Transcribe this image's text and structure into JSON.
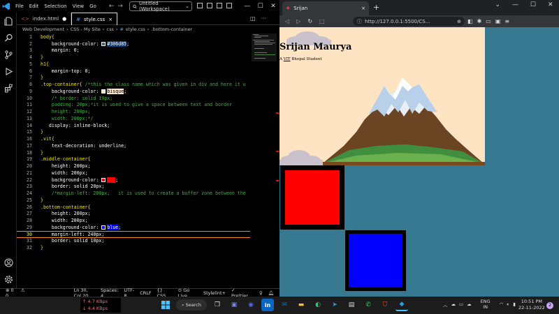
{
  "vscode": {
    "menu": [
      "File",
      "Edit",
      "Selection",
      "View",
      "Go"
    ],
    "command_center": "Untitled (Workspace)",
    "tabs": [
      {
        "label": "index.html",
        "modified": "●"
      },
      {
        "label": "style.css",
        "close": "×"
      }
    ],
    "breadcrumb": [
      "Web Development",
      "CSS - My Site",
      "css",
      "style.css",
      ".bottom-container"
    ],
    "breadcrumb_sep": "›",
    "window_controls": [
      "—",
      "☐",
      "✕"
    ],
    "status": {
      "errors": "0",
      "warnings": "0",
      "position": "Ln 30, Col 20",
      "spaces": "Spaces: 4",
      "encoding": "UTF-8",
      "eol": "CRLF",
      "language": "CSS",
      "golive": "Go Live",
      "stylelint": "Stylelint+",
      "prettier": "Prettier"
    },
    "line_numbers": [
      "1",
      "2",
      "3",
      "4",
      "5",
      "6",
      "7",
      "8",
      "9",
      "10",
      "11",
      "12",
      "13",
      "14",
      "15",
      "16",
      "17",
      "18",
      "19",
      "20",
      "21",
      "22",
      "23",
      "24",
      "25",
      "26",
      "27",
      "28",
      "29",
      "30",
      "31",
      "32"
    ],
    "code": {
      "l1a": "body{",
      "l2a": "background-color: ",
      "l2b": "#306d85",
      "l2c": ";",
      "l3a": "margin: ",
      "l3b": "0",
      "l3c": ";",
      "l4a": "}",
      "l5a": "h1{",
      "l6a": "margin-top: ",
      "l6b": "0",
      "l6c": ";",
      "l7a": "}",
      "l8a": ".top-container{ ",
      "l8b": "/*this the class name which was given in div and here it u",
      "l9a": "background-color: ",
      "l9b": "bisque",
      "l9c": ";",
      "l10a": "/* border: solid 10px;",
      "l11a": "padding: 20px;*it is used to give a space between text and border",
      "l12a": "height: 200px;",
      "l13a": "width: 200px;*/",
      "l14a": "display: ",
      "l14b": "inline-block",
      "l14c": ";",
      "l15a": "}",
      "l16a": ".vit{",
      "l17a": "text-decoration: ",
      "l17b": "underline",
      "l17c": ";",
      "l18a": "}",
      "l19a": ".middle-container{",
      "l20a": "height: ",
      "l20b": "200px",
      "l20c": ";",
      "l21a": "width: ",
      "l21b": "200px",
      "l21c": ";",
      "l22a": "background-color: ",
      "l22b": "red",
      "l22c": ";",
      "l23a": "border: ",
      "l23b": "solid 20px",
      "l23c": ";",
      "l24a": "/*margin-left: 200px;   it is used to create a buffer zone between the",
      "l25a": "}",
      "l26a": ".bottom-container{",
      "l27a": "height: ",
      "l27b": "200px",
      "l27c": ";",
      "l28a": "width: ",
      "l28b": "200px",
      "l28c": ";",
      "l29a": "background-color: ",
      "l29b": "blue",
      "l29c": ";",
      "l30a": "margin-left: ",
      "l30b": "240px",
      "l30c": ";",
      "l31a": "border: ",
      "l31b": "solid 10px",
      "l31c": ";",
      "l32a": "}"
    }
  },
  "browser": {
    "tab_title": "Srijan",
    "tab_close": "×",
    "new_tab": "+",
    "url": "http://127.0.0.1:5500/CS...",
    "window_controls": [
      "⌄",
      "—",
      "☐",
      "✕"
    ],
    "heading": "Srijan Maurya",
    "para_prefix": "A ",
    "para_link": "VIT",
    "para_suffix": " Bhopal Student"
  },
  "taskbar": {
    "net_up": "↑ 4.7 KBps",
    "net_down": "↓ 4.4 KBps",
    "search": "Search",
    "lang_top": "ENG",
    "lang_bottom": "IN",
    "time": "10:51 PM",
    "date": "22-11-2022",
    "notif": "2"
  },
  "colors": {
    "page_bg": "#306d85",
    "top_container": "#ffe4c4",
    "middle": "#ff0000",
    "bottom": "#0000ff"
  }
}
